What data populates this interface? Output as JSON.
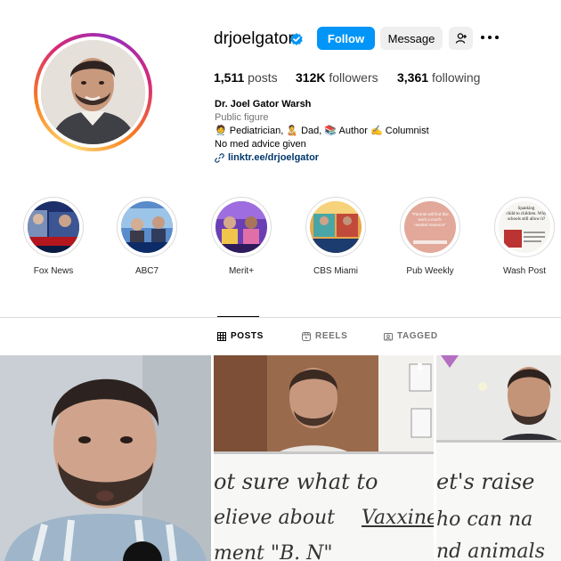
{
  "profile": {
    "username": "drjoelgator",
    "verified": true,
    "follow_label": "Follow",
    "message_label": "Message"
  },
  "stats": {
    "posts_count": "1,511",
    "posts_label": "posts",
    "followers_count": "312K",
    "followers_label": "followers",
    "following_count": "3,361",
    "following_label": "following"
  },
  "bio": {
    "name": "Dr. Joel Gator Warsh",
    "category": "Public figure",
    "line1": "🧑‍⚕️ Pediatrician, 🧑‍🍼 Dad, 📚 Author ✍️ Columnist",
    "line2": "No med advice given",
    "link": "linktr.ee/drjoelgator"
  },
  "highlights": [
    {
      "label": "Fox News"
    },
    {
      "label": "ABC7"
    },
    {
      "label": "Merit+"
    },
    {
      "label": "CBS Miami"
    },
    {
      "label": "Pub Weekly"
    },
    {
      "label": "Wash Post"
    }
  ],
  "highlight_thumb_text": {
    "pub_weekly": "\"Parents will find this work a much-needed resource\"",
    "wash_post_1": "Spanking",
    "wash_post_2": "child to children. Why",
    "wash_post_3": "schools still allow it?",
    "cbs": "THE DOCTOR IS IN"
  },
  "tabs": {
    "posts": "POSTS",
    "reels": "REELS",
    "tagged": "TAGGED"
  },
  "posts": {
    "post2_line1": "ot sure what to",
    "post2_line2": "elieve about",
    "post2_line2b": "Vaxxine",
    "post2_line3": "ment \"B. N\"",
    "post3_line1": "et's raise",
    "post3_line2": "ho can na",
    "post3_line3": "nd animals"
  },
  "colors": {
    "follow_blue": "#0095f6",
    "verified_blue": "#0095f6",
    "link_color": "#00376b",
    "secondary_text": "#737373"
  }
}
